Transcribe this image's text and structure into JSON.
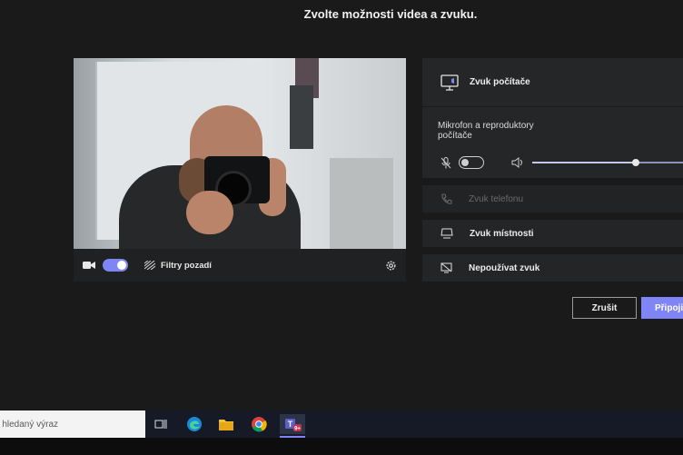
{
  "page": {
    "title": "Zvolte možnosti videa a zvuku."
  },
  "video": {
    "filters_label": "Filtry pozadí",
    "camera_on": true
  },
  "audio": {
    "computer_audio_label": "Zvuk počítače",
    "device_label": "Mikrofon a reproduktory počítače",
    "mic_on": false,
    "volume_fraction": 0.68,
    "phone_audio_label": "Zvuk telefonu",
    "room_audio_label": "Zvuk místnosti",
    "no_audio_label": "Nepoužívat zvuk"
  },
  "buttons": {
    "cancel_label": "Zrušit",
    "join_label": "Připoji"
  },
  "taskbar": {
    "search_placeholder": "e hledaný výraz",
    "teams_badge": "9+"
  },
  "colors": {
    "accent": "#7f85f5",
    "background": "#1a1a1a",
    "panel": "#252627"
  },
  "icons": [
    "video-camera-icon",
    "background-filters-icon",
    "gear-icon",
    "computer-audio-icon",
    "mic-off-icon",
    "speaker-icon",
    "phone-icon",
    "room-audio-icon",
    "no-audio-icon",
    "task-view-icon",
    "edge-icon",
    "file-explorer-icon",
    "chrome-icon",
    "teams-icon"
  ]
}
